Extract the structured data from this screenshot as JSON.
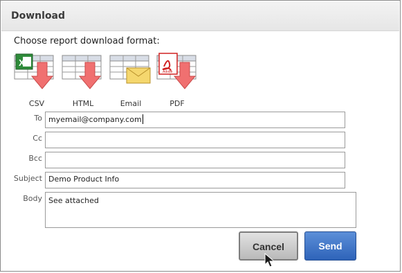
{
  "dialog": {
    "title": "Download",
    "prompt": "Choose report download format:"
  },
  "formats": [
    {
      "label": "CSV",
      "icon": "csv-excel-download-icon"
    },
    {
      "label": "HTML",
      "icon": "html-table-download-icon"
    },
    {
      "label": "Email",
      "icon": "email-envelope-icon"
    },
    {
      "label": "PDF",
      "icon": "pdf-download-icon"
    }
  ],
  "email_form": {
    "to_label": "To",
    "to_value": "myemail@company.com",
    "cc_label": "Cc",
    "cc_value": "",
    "bcc_label": "Bcc",
    "bcc_value": "",
    "subject_label": "Subject",
    "subject_value": "Demo Product Info",
    "body_label": "Body",
    "body_value": "See attached"
  },
  "buttons": {
    "cancel_label": "Cancel",
    "send_label": "Send"
  },
  "colors": {
    "send_button": "#3a6fc4",
    "arrow": "#f07070",
    "excel_green": "#2e8b3a",
    "pdf_red": "#d02020",
    "envelope": "#f5d76e"
  }
}
